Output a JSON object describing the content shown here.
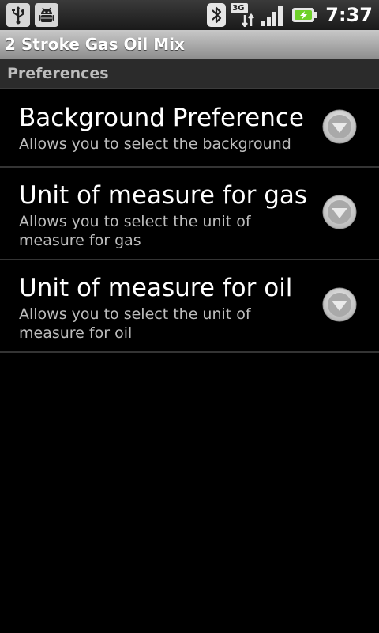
{
  "status_bar": {
    "left_icons": [
      "usb-icon",
      "android-debug-icon"
    ],
    "right_icons": [
      "bluetooth-icon",
      "network-3g-icon",
      "signal-icon",
      "battery-charging-icon"
    ],
    "network_label": "3G",
    "time": "7:37"
  },
  "app": {
    "title": "2 Stroke Gas Oil Mix"
  },
  "preferences": {
    "category": "Preferences",
    "items": [
      {
        "title": "Background Preference",
        "summary": "Allows you to select the background",
        "icon": "dropdown-arrow-icon"
      },
      {
        "title": "Unit of measure for gas",
        "summary": "Allows you to select the unit of measure for gas",
        "icon": "dropdown-arrow-icon"
      },
      {
        "title": "Unit of measure for oil",
        "summary": "Allows you to select the unit of measure for oil",
        "icon": "dropdown-arrow-icon"
      }
    ]
  },
  "colors": {
    "background": "#000000",
    "title_bar": "#a8a8a8",
    "category_bar": "#2b2b2b",
    "summary_text": "#bdbdbd",
    "battery_accent": "#6fd12a"
  }
}
